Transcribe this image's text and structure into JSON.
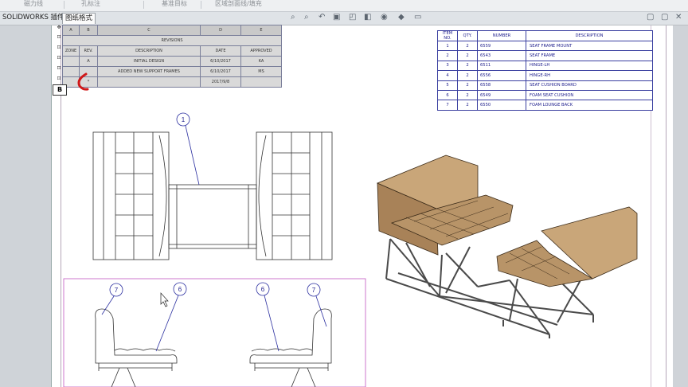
{
  "toolbar": {
    "items": [
      "磁力线",
      "孔标注",
      "基准目标",
      "区域剖面线/填充"
    ]
  },
  "tabs": {
    "addins": "SOLIDWORKS 插件",
    "format": "图纸格式"
  },
  "revision_table": {
    "columns": [
      "A",
      "B",
      "C",
      "D",
      "E"
    ],
    "title": "REVISIONS",
    "headers": [
      "ZONE",
      "REV.",
      "DESCRIPTION",
      "DATE",
      "APPROVED"
    ],
    "rows": [
      {
        "zone": "",
        "rev": "A",
        "description": "INITIAL DESIGN",
        "date": "6/10/2017",
        "approved": "KA"
      },
      {
        "zone": "",
        "rev": "",
        "description": "ADDED NEW SUPPORT FRAMES",
        "date": "6/10/2017",
        "approved": "MS"
      },
      {
        "zone": "",
        "rev": "*",
        "description": "",
        "date": "2017/9/8",
        "approved": ""
      }
    ],
    "marker": "B"
  },
  "bom_table": {
    "headers": [
      "ITEM NO.",
      "QTY.",
      "NUMBER",
      "DESCRIPTION"
    ],
    "rows": [
      {
        "item": "1",
        "qty": "2",
        "number": "6559",
        "description": "SEAT FRAME MOUNT"
      },
      {
        "item": "2",
        "qty": "2",
        "number": "6543",
        "description": "SEAT FRAME"
      },
      {
        "item": "3",
        "qty": "2",
        "number": "6511",
        "description": "HINGE-LH"
      },
      {
        "item": "4",
        "qty": "2",
        "number": "6556",
        "description": "HINGE-RH"
      },
      {
        "item": "5",
        "qty": "2",
        "number": "6558",
        "description": "SEAT CUSHION BOARD"
      },
      {
        "item": "6",
        "qty": "2",
        "number": "6549",
        "description": "FOAM SEAT CUSHION"
      },
      {
        "item": "7",
        "qty": "2",
        "number": "6550",
        "description": "FOAM LOUNGE BACK"
      }
    ]
  },
  "balloons": {
    "top_view": "1",
    "front_left_outer": "7",
    "front_left_inner": "6",
    "front_right_inner": "6",
    "front_right_outer": "7"
  },
  "colors": {
    "table_border": "#3a3fa0",
    "table_text": "#1e1e8c",
    "annotation_red": "#d01818",
    "seat_tan": "#b89468",
    "frame_dark": "#4a4a4a"
  }
}
